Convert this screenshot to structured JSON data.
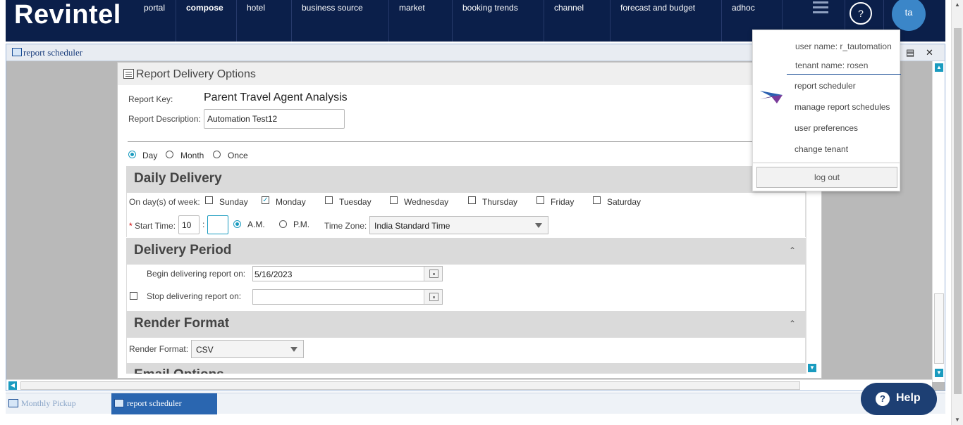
{
  "app": {
    "logo": "Revintel",
    "nav": [
      "portal",
      "compose",
      "hotel",
      "business source",
      "market",
      "booking trends",
      "channel",
      "forecast and budget",
      "adhoc"
    ],
    "help_symbol": "?",
    "avatar_initials": "ta"
  },
  "window": {
    "title": "report scheduler"
  },
  "dialog": {
    "title": "Report Delivery Options",
    "report_key_label": "Report Key:",
    "report_key_value": "Parent Travel Agent Analysis",
    "report_desc_label": "Report Description:",
    "report_desc_value": "Automation Test12",
    "frequency": [
      "Day",
      "Month",
      "Once"
    ],
    "frequency_selected": "Day",
    "daily": {
      "title": "Daily Delivery",
      "days_label": "On day(s) of week:",
      "days": [
        "Sunday",
        "Monday",
        "Tuesday",
        "Wednesday",
        "Thursday",
        "Friday",
        "Saturday"
      ],
      "days_checked": [
        "Monday"
      ],
      "start_time_label": "Start Time:",
      "required_mark": "*",
      "hour": "10",
      "minute": "",
      "colon": ":",
      "am_label": "A.M.",
      "pm_label": "P.M.",
      "ampm_selected": "A.M.",
      "timezone_label": "Time Zone:",
      "timezone_value": "India Standard Time"
    },
    "period": {
      "title": "Delivery Period",
      "begin_label": "Begin delivering report on:",
      "begin_value": "5/16/2023",
      "stop_label": "Stop delivering report on:",
      "stop_value": ""
    },
    "render": {
      "title": "Render Format",
      "format_label": "Render Format:",
      "format_value": "CSV"
    },
    "email": {
      "title": "Email Options"
    }
  },
  "user_menu": {
    "user_name": "user name: r_tautomation",
    "tenant_name": "tenant name: rosen",
    "items": [
      "report scheduler",
      "manage report schedules",
      "user preferences",
      "change tenant"
    ],
    "logout": "log out"
  },
  "taskbar": {
    "tasks": [
      "Monthly Pickup",
      "report scheduler"
    ],
    "active": "report scheduler"
  },
  "help_button": "Help",
  "colors": {
    "nav_bg": "#0b1f4a",
    "accent": "#1a9bbf",
    "avatar": "#3b86c8",
    "task_active": "#2a66b0",
    "help_pill": "#1d3f73"
  }
}
